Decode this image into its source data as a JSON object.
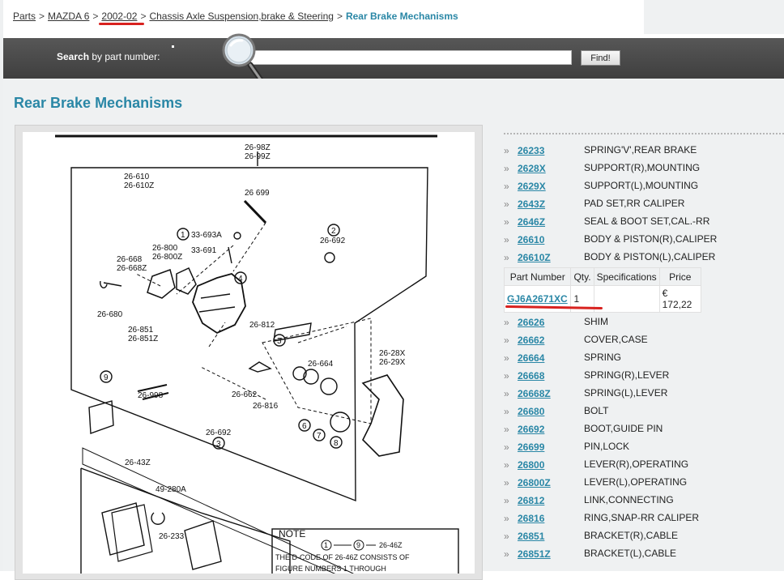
{
  "breadcrumb": {
    "items": [
      "Parts",
      "MAZDA 6",
      "2002-02",
      "Chassis Axle Suspension,brake & Steering"
    ],
    "separator": ">",
    "current": "Rear Brake Mechanisms"
  },
  "search": {
    "label_bold": "Search",
    "label_rest": " by part number:",
    "value": "",
    "button": "Find!"
  },
  "page": {
    "title": "Rear Brake Mechanisms"
  },
  "parts_before": [
    {
      "num": "26233",
      "desc": "SPRING'V',REAR BRAKE"
    },
    {
      "num": "2628X",
      "desc": "SUPPORT(R),MOUNTING"
    },
    {
      "num": "2629X",
      "desc": "SUPPORT(L),MOUNTING"
    },
    {
      "num": "2643Z",
      "desc": "PAD SET,RR CALIPER"
    },
    {
      "num": "2646Z",
      "desc": "SEAL & BOOT SET,CAL.-RR"
    },
    {
      "num": "26610",
      "desc": "BODY & PISTON(R),CALIPER"
    },
    {
      "num": "26610Z",
      "desc": "BODY & PISTON(L),CALIPER"
    }
  ],
  "detail": {
    "headers": [
      "Part Number",
      "Qty.",
      "Specifications",
      "Price"
    ],
    "row": {
      "part_number": "GJ6A2671XC",
      "qty": "1",
      "spec": "",
      "price": "€ 172,22"
    }
  },
  "parts_after": [
    {
      "num": "26626",
      "desc": "SHIM"
    },
    {
      "num": "26662",
      "desc": "COVER,CASE"
    },
    {
      "num": "26664",
      "desc": "SPRING"
    },
    {
      "num": "26668",
      "desc": "SPRING(R),LEVER"
    },
    {
      "num": "26668Z",
      "desc": "SPRING(L),LEVER"
    },
    {
      "num": "26680",
      "desc": "BOLT"
    },
    {
      "num": "26692",
      "desc": "BOOT,GUIDE PIN"
    },
    {
      "num": "26699",
      "desc": "PIN,LOCK"
    },
    {
      "num": "26800",
      "desc": "LEVER(R),OPERATING"
    },
    {
      "num": "26800Z",
      "desc": "LEVER(L),OPERATING"
    },
    {
      "num": "26812",
      "desc": "LINK,CONNECTING"
    },
    {
      "num": "26816",
      "desc": "RING,SNAP-RR CALIPER"
    },
    {
      "num": "26851",
      "desc": "BRACKET(R),CABLE"
    },
    {
      "num": "26851Z",
      "desc": "BRACKET(L),CABLE"
    }
  ],
  "diagram": {
    "labels": {
      "l1": "26-98Z",
      "l2": "26-99Z",
      "l3": "26-610",
      "l4": "26-610Z",
      "l5": "26 699",
      "l6": "33-693A",
      "l7": "26-800",
      "l8": "26-800Z",
      "l9": "33-691",
      "l10": "26-692",
      "l11": "26-668",
      "l12": "26-668Z",
      "l13": "26-680",
      "l14": "26-851",
      "l15": "26-851Z",
      "l16": "26-812",
      "l17": "26-664",
      "l18": "26-28X",
      "l19": "26-29X",
      "l20": "26-662",
      "l21": "26-816",
      "l22": "26-998",
      "l23": "26-692",
      "l24": "26-43Z",
      "l25": "49-280A",
      "l26": "26-233",
      "c1": "1",
      "c2": "2",
      "c3": "3",
      "c4": "4",
      "c5": "5",
      "c6": "6",
      "c7": "7",
      "c8": "8",
      "c9": "9"
    },
    "note": {
      "title": "NOTE",
      "line1_a": "1",
      "line1_b": "9",
      "line1_c": "26-46Z",
      "line2": "THE D-CODE OF   26-46Z   CONSISTS OF",
      "line3": "FIGURE NUMBERS   1   THROUGH"
    }
  },
  "colors": {
    "accent": "#2a87a6",
    "highlight": "#d8221f",
    "bar": "#4a4a4a"
  },
  "icons": {
    "search": "magnifier-icon",
    "list_bullet": "double-chevron-icon"
  }
}
